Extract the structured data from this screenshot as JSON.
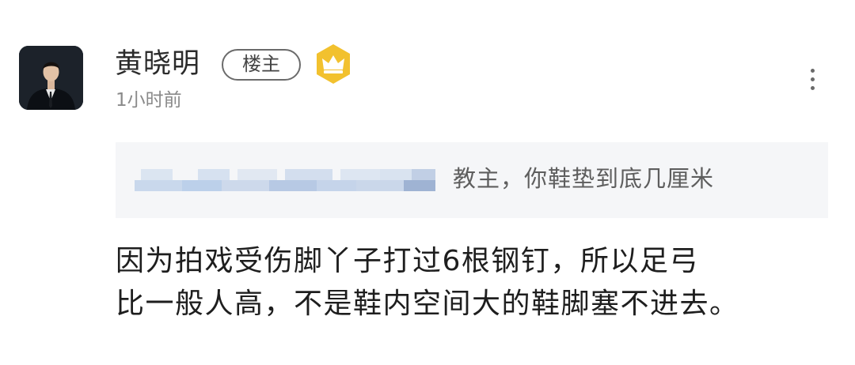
{
  "comment": {
    "author": {
      "name": "黄晓明",
      "badge": "楼主",
      "avatar_icon": "avatar-photo",
      "level_icon": "crown-badge-icon",
      "level_color": "#F2C12E"
    },
    "time": "1小时前",
    "more_icon": "more-vertical-icon",
    "quote": {
      "text": "教主，你鞋垫到底几厘米"
    },
    "reply_lines": [
      "因为拍戏受伤脚丫子打过6根钢钉，所以足弓",
      "比一般人高，不是鞋内空间大的鞋脚塞不进去。"
    ]
  }
}
